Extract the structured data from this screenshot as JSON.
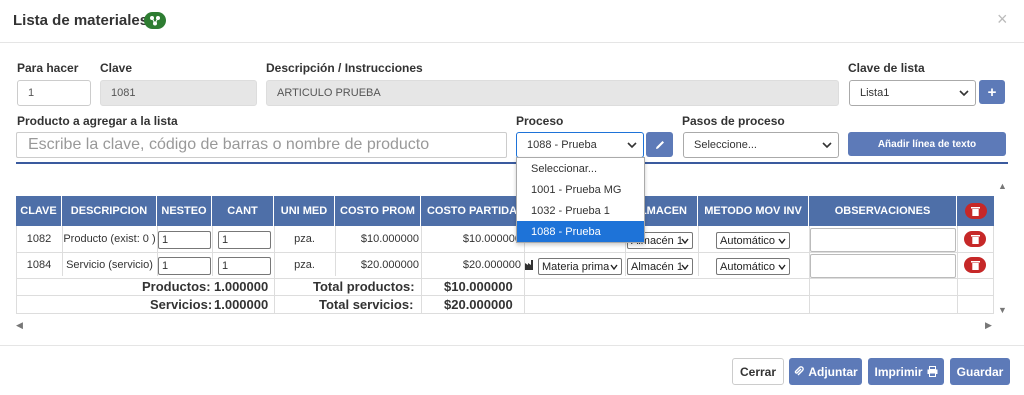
{
  "dialog": {
    "title": "Lista de materiales",
    "close_glyph": "×"
  },
  "form": {
    "para_hacer_label": "Para hacer",
    "para_hacer_value": "1",
    "clave_label": "Clave",
    "clave_value": "1081",
    "descripcion_label": "Descripción / Instrucciones",
    "descripcion_value": "ARTICULO PRUEBA",
    "clave_lista_label": "Clave de lista",
    "clave_lista_value": "Lista1",
    "add_list_glyph": "+",
    "producto_label": "Producto a agregar a la lista",
    "producto_placeholder": "Escribe la clave, código de barras o nombre de producto",
    "proceso_label": "Proceso",
    "proceso_value": "1088 - Prueba",
    "pasos_label": "Pasos de proceso",
    "pasos_value": "Seleccione...",
    "add_line_label": "Añadir línea de texto"
  },
  "proceso_options": [
    "Seleccionar...",
    "1001 - Prueba MG",
    "1032 - Prueba 1",
    "1088 - Prueba"
  ],
  "table": {
    "headers": [
      "CLAVE",
      "DESCRIPCION",
      "NESTEO",
      "CANT",
      "UNI MED",
      "COSTO PROM",
      "COSTO PARTIDA",
      "ALMACEN",
      "METODO MOV INV",
      "OBSERVACIONES"
    ],
    "rows": [
      {
        "clave": "1082",
        "descripcion": "Producto (exist: 0 )",
        "nesteo": "1",
        "cant": "1",
        "unimed": "pza.",
        "costo_prom": "$10.000000",
        "costo_partida": "$10.000000",
        "tipo": "",
        "almacen": "Almacén 1",
        "metodo": "Automático"
      },
      {
        "clave": "1084",
        "descripcion": "Servicio (servicio)",
        "nesteo": "1",
        "cant": "1",
        "unimed": "pza.",
        "costo_prom": "$20.000000",
        "costo_partida": "$20.000000",
        "tipo": "Materia prima",
        "almacen": "Almacén 1",
        "metodo": "Automático"
      }
    ],
    "totals": {
      "productos_label": "Productos:",
      "productos_value": "1.000000",
      "servicios_label": "Servicios:",
      "servicios_value": "1.000000",
      "total_productos_label": "Total productos:",
      "total_productos_value": "$10.000000",
      "total_servicios_label": "Total servicios:",
      "total_servicios_value": "$20.000000"
    }
  },
  "footer": {
    "cerrar": "Cerrar",
    "adjuntar": "Adjuntar",
    "imprimir": "Imprimir",
    "guardar": "Guardar"
  },
  "colors": {
    "header_blue": "#4e6fa8",
    "button_blue": "#5d7ab8",
    "danger": "#c62828",
    "highlight": "#1e73d8",
    "badge_green": "#2e7d32"
  }
}
